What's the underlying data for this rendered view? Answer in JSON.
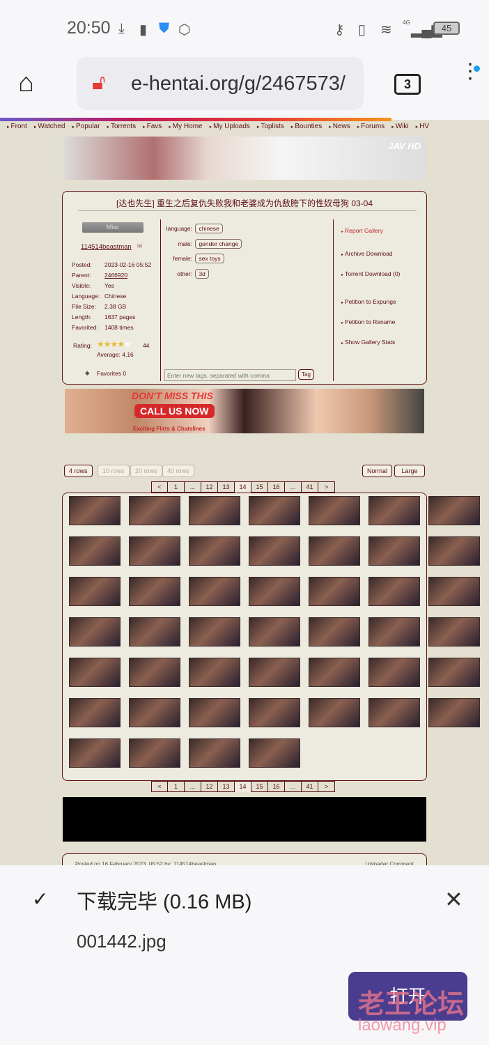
{
  "status_bar": {
    "time": "20:50",
    "battery": "45",
    "network": "4G"
  },
  "browser": {
    "url": "e-hentai.org/g/2467573/",
    "tab_count": "3"
  },
  "nav": [
    "Front",
    "Watched",
    "Popular",
    "Torrents",
    "Favs",
    "My Home",
    "My Uploads",
    "Toplists",
    "Bounties",
    "News",
    "Forums",
    "Wiki",
    "HV"
  ],
  "banner": {
    "logo": "JAV HD"
  },
  "gallery": {
    "title": "[达也先生] 重生之后复仇失败我和老婆成为仇敌胯下的性奴母狗 03-04",
    "category": "Misc",
    "uploader": "114514beastman",
    "info": [
      [
        "Posted:",
        "2023-02-16 05:52"
      ],
      [
        "Parent:",
        "2466920"
      ],
      [
        "Visible:",
        "Yes"
      ],
      [
        "Language:",
        "Chinese"
      ],
      [
        "File Size:",
        "2.38 GB"
      ],
      [
        "Length:",
        "1637 pages"
      ],
      [
        "Favorited:",
        "1408 times"
      ]
    ],
    "rating_label": "Rating:",
    "rating_count": "44",
    "rating_average": "Average: 4.16",
    "rating_stars": 4.16,
    "favorites": "Favorites 0",
    "tags": [
      [
        "language:",
        "chinese"
      ],
      [
        "male:",
        "gender change"
      ],
      [
        "female:",
        "sex toys"
      ],
      [
        "other:",
        "3d"
      ]
    ],
    "tag_placeholder": "Enter new tags, separated with comma",
    "tag_button": "Tag",
    "actions": [
      "Report Gallery",
      "Archive Download",
      "Torrent Download (0)",
      "Petition to Expunge",
      "Petition to Rename",
      "Show Gallery Stats"
    ]
  },
  "ad": {
    "headline": "DON'T MISS THIS",
    "cta": "CALL US NOW",
    "sub": "Exciting Flirts & Chatslines"
  },
  "rows": [
    "4 rows",
    "10 rows",
    "20 rows",
    "40 rows"
  ],
  "sizes": [
    "Normal",
    "Large"
  ],
  "pager": [
    "<",
    "1",
    "...",
    "12",
    "13",
    "14",
    "15",
    "16",
    "...",
    "41",
    ">"
  ],
  "current_page": "14",
  "thumbnails_count": 46,
  "comment": {
    "posted": "Posted on 16 February 2023, 05:52 by:   114514beastman",
    "label": "Uploader Comment"
  },
  "download": {
    "status": "下载完毕 (0.16 MB)",
    "filename": "001442.jpg",
    "open": "打开"
  },
  "watermark": {
    "title": "老王论坛",
    "site": "laowang.vip"
  }
}
